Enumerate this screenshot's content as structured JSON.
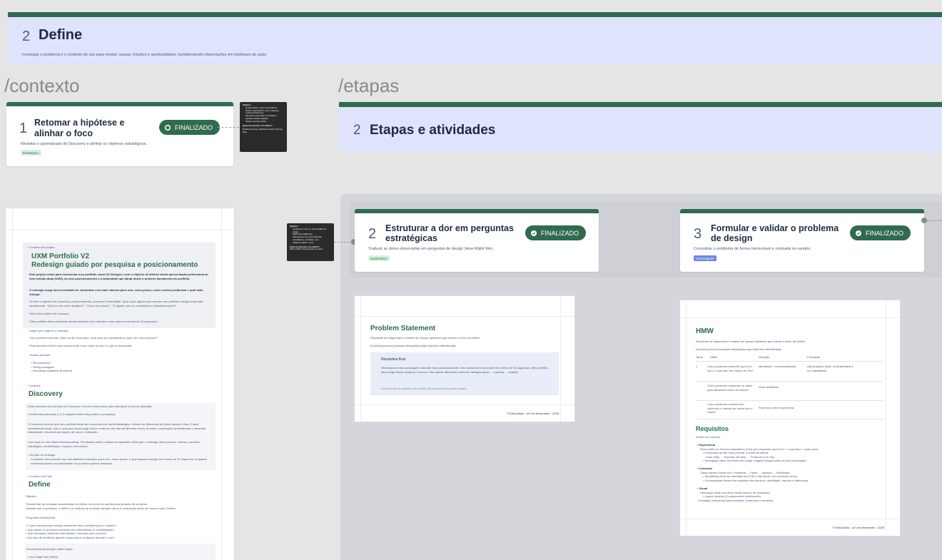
{
  "banner": {
    "number": "2",
    "title": "Define",
    "subtitle": "Investigar o problema e o contexto de uso para revelar causas, fricções e oportunidades, transformando observações em hipóteses de ação."
  },
  "labels": {
    "contexto": "/contexto",
    "etapas": "/etapas"
  },
  "card1": {
    "number": "1",
    "title_line1": "Retomar a hipótese e",
    "title_line2": "alinhar o foco",
    "desc": "Revisitar o aprendizado do Discovery e alinhar os objetivos estratégicos.",
    "tag": "Estratégico",
    "badge": "FINALIZADO"
  },
  "note1": {
    "heading": "Objetivo:",
    "items": [
      "contextualizar o ponto de partida do Define, relembrando o que a hipótese central do Discovery.",
      "Elementos essenciais do problema",
      "Hipótese central validada",
      "Objetivo da fase Define."
    ],
    "q": "Quais ferramentas vou utilizar?",
    "tools": "Desktop Framing, Hipótese Central, Domínio Map."
  },
  "etapas_header": {
    "number": "2",
    "title": "Etapas e atividades"
  },
  "note2": {
    "heading": "Objetivo:",
    "items": [
      "transformar a dor em oportunidade de design.",
      "HMW (How Might We)",
      "Agrupamento de forças (dilemas, contradições, condições, etc.)",
      "Tabela de HMW + Foco."
    ],
    "q": "Quais ferramentas vou utilizar?",
    "tools": "Matriz HMW, Clusterização de temas."
  },
  "card2": {
    "number": "2",
    "title_line1": "Estruturar a dor em perguntas",
    "title_line2": "estratégicas",
    "desc": "Traduzir as dores observadas em perguntas de design (How Might We).",
    "tag": "Exploratório",
    "badge": "FINALIZADO"
  },
  "card3": {
    "number": "3",
    "title_line1": "Formular e validar o problema",
    "title_line2": "de design",
    "desc": "Consolidar o problema de forma mensurável e centrada no usuário.",
    "tag": "Convergente",
    "badge": "FINALIZADO"
  },
  "doc_left": {
    "ctx_label": "Contexto do projeto",
    "title1": "UXM Portfolio V2",
    "title2": "Redesign guiado por pesquisa e posicionamento",
    "p1": "Este projeto existe para redesenhar meu portfólio como UX Designer, com o objetivo de alinhar minha apresentação profissional ao meu método atual (UXM), ao meu posicionamento e à maturidade que atingi desde o primeiro lançamento do portfólio.",
    "p2": "O redesign surge da necessidade de comunicar com mais clareza quem sou, como penso, como resolvo problemas e qual valor entrego.",
    "p3": "Ele tem o objetivo de comunicar: posicionamento, processo e identidade. Quero que alguém que acesse meu portfólio consiga responder rapidamente: \"Quem é ele como designer?\", \"Como ele pensa?\", \"E alguém que eu contrataria ou trabalharia junto?\"",
    "p4": "North Star (critério de sucesso)",
    "p5": "\"Meu portfólio deve comunicar minha essência, meu método e meu valor em menos de 10 segundos.\"",
    "p6": "Insight que originou o redesign",
    "p7": "\"Seu portfólio está bom. Mas me diz uma coisa: você quer ser contratada ou quer ser uma empresa?\"",
    "p8": "Essa fala/será revirou uma desconexão entre o que eu falo e o que eu transmitia.",
    "p9": "Usuário primário",
    "users": [
      "Recrutadores",
      "Hiring managers",
      "Empresas avaliando fit cultural"
    ],
    "ins_label": "Insumos",
    "discovery": "Discovery",
    "d1": "Estes insumos vêm prontos do Discovery e servem como base para estruturar o foco da definição.",
    "d2": "• Evidências principais (1 a 3 insights vindos da jornada ou pesquisa)",
    "d3": "O Discovery revelou que meu portfólio atual não comunica meu perfil estratégico, método ou diferencial de forma rápida e clara. Existe consistência visual, mas a estrutura visual exige leitura contínua, não atende diferente níveis de leitor e exploração profundidade e transmite maturidade, reduzindo percepção de valor e motivação.",
    "d4": "Com base no Job Market Benchmarking, Feedbacks reais e análise comparativa, defini que o redesign deve priorizar: clareza, narrativa estratégica, credibilidade e impacto memorável.",
    "d5": "• Direção do redesign",
    "d6": "O portfólio deve permitir que recrutadores entendam quem sou, como penso, e qual impacto entrego em menos de 10 segundos, enquanto mantendo acesso à profundidade do processo quando desejado.",
    "def_label": "Contexto da Fase",
    "define": "Define",
    "o1": "Objetivo",
    "o2": "Transformar as entregas consolidadas do Define em ponto de partida para geração de soluções.",
    "o3": "Garantir que o problema, o HMW e os critérios de sucesso estejam claros e priorizados antes de iniciar a fase Criativa.",
    "pn": "Perguntas Norteadoras",
    "q": [
      "O que tornaria essa solução realmente útil e confiável para o usuário?",
      "Que partes do processo precisam ser automáticas ou simplificadas?",
      "Que interações mínimas mais fluidas e diversas para a tarefa?",
      "Que tipo de feedback garante segurança e confiança durante o uso?"
    ],
    "fu": "Ferramentas (execução nesta etapa)",
    "fu1": "• How Might We (HMW)"
  },
  "doc_problem": {
    "title": "Problem Statement",
    "l1": "Resultado do diagnóstico e análise de causas hipóteses que orienta o início do Define.",
    "l2": "[Usuário] precisa [resultado desejado] porque [barreira identificada].",
    "box_title": "Resolutiva final",
    "box_text": "Recrutadores não conseguem entender meu posicionamento, meu raciocínio e meu valor em menos de 10 segundos. Meu portfólio atual exige leitura contínua, e linear e não atende diferentes níveis de interação (scan → explorar → avaliar).",
    "box_note": "Essa resolução foi utilizada como entrada, são as ideias que o primeiro elegivel.",
    "footer": "© Erika Dário · UX em Movimento · 2025"
  },
  "doc_hmw": {
    "title": "HMW",
    "l1": "Resultado do diagnóstico e análise de causas hipóteses que orienta o início do Define.",
    "l2": "[Usuário] precisa [resultado desejado] porque [barreira identificada].",
    "headers": [
      "Tema",
      "HMW",
      "Intenção",
      "Prioridade"
    ],
    "rows": [
      [
        "1",
        "Como podemos transmitir quem eu sou e o que faço em menos de 10s?",
        "Identidade + escaneabilidade",
        "Alta (impacto direto na atratividade e na usabilidade)"
      ],
      [
        "",
        "Como podemos estruturar os cases para diferentes níveis de leitura?",
        "Nível detalhado",
        ""
      ],
      [
        "",
        "Como podemos mostrar meu raciocínio e método de forma leve e visual?",
        "Processo como experiência",
        ""
      ]
    ],
    "req_title": "Requisitos",
    "req_sub": "Dividir em 3 blocos:",
    "r1": "• Experiência",
    "r1a": "Deve exibir um resumo instantâneo (10s) que responda: quem sou + o que faço + para quem",
    "r1b": "• A estrutura do site deve permitir 3 níveis de leitura:",
    "r1c": "Scan (30s) → Explorar (40-90s) → Profundo (3-5 min)",
    "r1d": "• Navegação deve ser fluida sem exigir rolagens longas antes do topo antecipado.",
    "r2": "• Conteúdo",
    "r2a": "Cases devem iniciar com: Problema → Papel → Impacto → Resultado.",
    "r2b": "• Storytelling deve ser orientado ao UXM e não linear, com módulos curtos.",
    "r2c": "• Cm/umstratas devem ser explicitar não técnicos: Identidade, método e diferencial.",
    "r3": "• Visual",
    "r3a": "Hierarquia clara com ritmo visual (pontos de descanso).",
    "r3b": "• Layout modular (Componentes reutilizáveis).",
    "r3c": "• Destaque intencional para métricas, conteúdos e decisões.",
    "footer": "© Erika Dário · UX em Movimento · 2025"
  }
}
